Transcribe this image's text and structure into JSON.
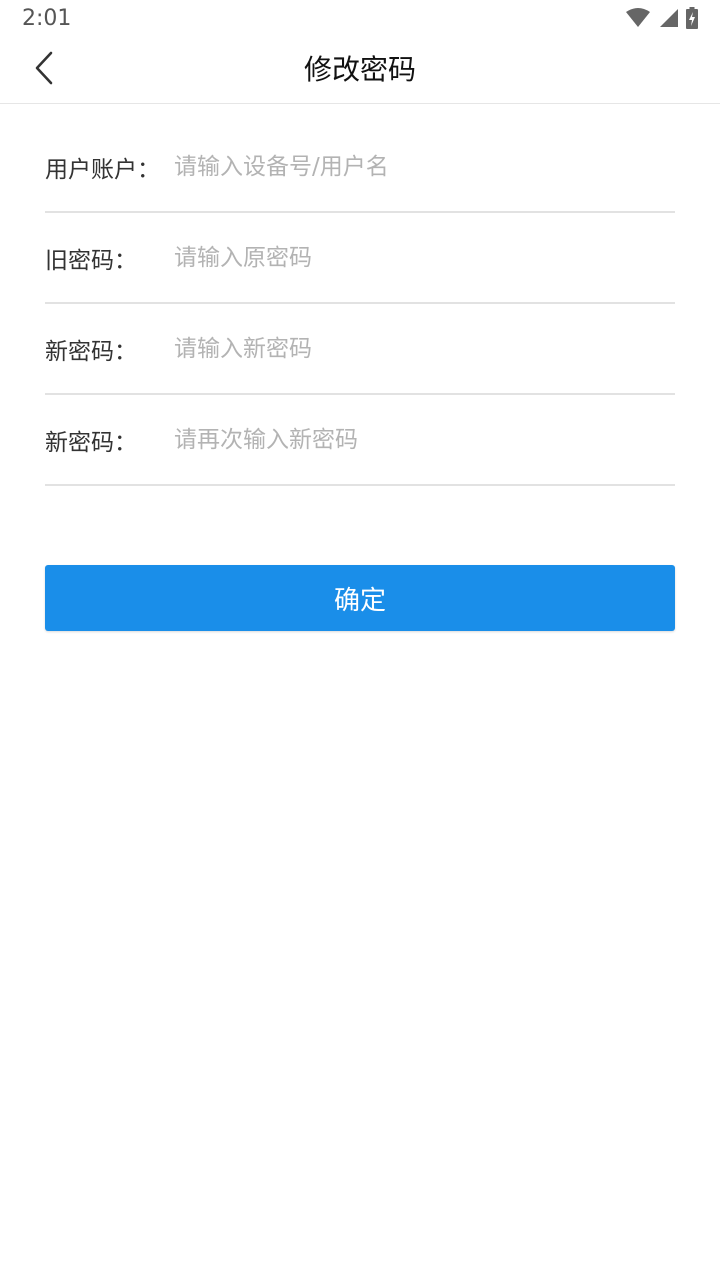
{
  "status_bar": {
    "time": "2:01",
    "icons": [
      "wifi-icon",
      "signal-icon",
      "battery-charging-icon"
    ]
  },
  "nav": {
    "back_icon": "chevron-left-icon",
    "title": "修改密码"
  },
  "form": {
    "fields": [
      {
        "label": "用户账户：",
        "placeholder": "请输入设备号/用户名",
        "value": ""
      },
      {
        "label": "旧密码：",
        "placeholder": "请输入原密码",
        "value": ""
      },
      {
        "label": "新密码：",
        "placeholder": "请输入新密码",
        "value": ""
      },
      {
        "label": "新密码：",
        "placeholder": "请再次输入新密码",
        "value": ""
      }
    ]
  },
  "submit": {
    "label": "确定"
  },
  "colors": {
    "accent": "#1a8ee9",
    "placeholder": "#b3b3b3",
    "divider": "#e2e2e2",
    "text": "#333333"
  }
}
